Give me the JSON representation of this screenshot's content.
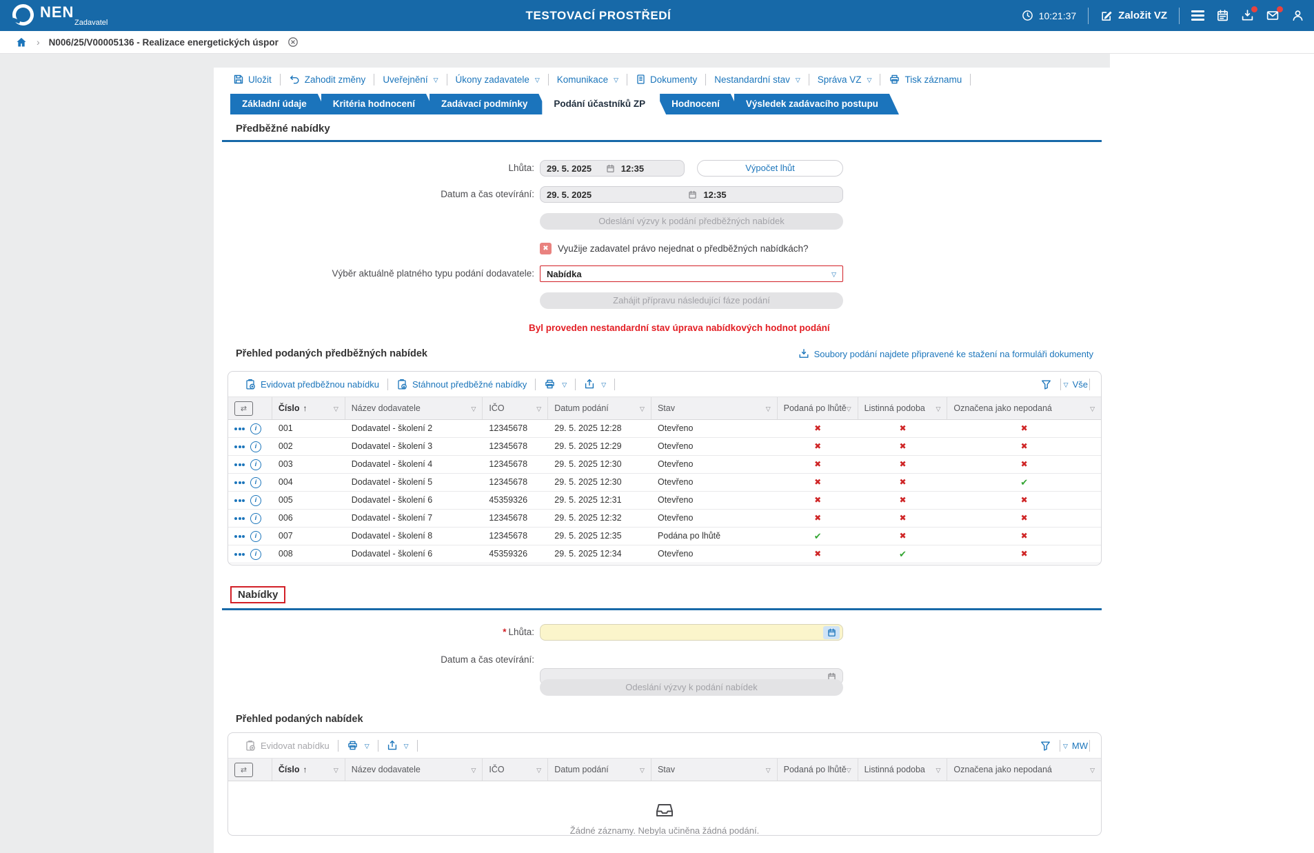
{
  "topbar": {
    "brand": "NEN",
    "brand_sub": "Zadavatel",
    "env_title": "TESTOVACÍ PROSTŘEDÍ",
    "time": "10:21:37",
    "create_vz": "Založit VZ"
  },
  "breadcrumb": {
    "item": "N006/25/V00005136 - Realizace energetických úspor"
  },
  "toolbar": {
    "items": [
      {
        "label": "Uložit"
      },
      {
        "label": "Zahodit změny"
      },
      {
        "label": "Uveřejnění"
      },
      {
        "label": "Úkony zadavatele"
      },
      {
        "label": "Komunikace"
      },
      {
        "label": "Dokumenty"
      },
      {
        "label": "Nestandardní stav"
      },
      {
        "label": "Správa VZ"
      },
      {
        "label": "Tisk záznamu"
      }
    ]
  },
  "tabs": [
    {
      "label": "Základní údaje"
    },
    {
      "label": "Kritéria hodnocení"
    },
    {
      "label": "Zadávací podmínky"
    },
    {
      "label": "Podání účastníků ZP"
    },
    {
      "label": "Hodnocení"
    },
    {
      "label": "Výsledek zadávacího postupu"
    }
  ],
  "table_columns": [
    "Číslo",
    "Název dodavatele",
    "IČO",
    "Datum podání",
    "Stav",
    "Podaná po lhůtě",
    "Listinná podoba",
    "Označena jako nepodaná"
  ],
  "section1": {
    "title": "Předběžné nabídky",
    "deadline_label": "Lhůta:",
    "deadline_date": "29. 5. 2025",
    "deadline_time": "12:35",
    "calc_btn": "Výpočet lhůt",
    "opening_label": "Datum a čas otevírání:",
    "opening_date": "29. 5. 2025",
    "opening_time": "12:35",
    "send_call_btn": "Odeslání výzvy k podání předběžných nabídek",
    "question": "Využije zadavatel právo nejednat o předběžných nabídkách?",
    "type_label": "Výběr aktuálně platného typu podání dodavatele:",
    "type_value": "Nabídka",
    "next_phase_btn": "Zahájit přípravu následující fáze podání",
    "warning": "Byl proveden nestandardní stav úprava nabídkových hodnot podání",
    "overview_title": "Přehled podaných předběžných nabídek",
    "files_link": "Soubory podání najdete připravené ke stažení na formuláři dokumenty",
    "tb_register": "Evidovat předběžnou nabídku",
    "tb_download": "Stáhnout předběžné nabídky",
    "filter_preset": "Vše",
    "rows": [
      {
        "cislo": "001",
        "nazev": "Dodavatel - školení 2",
        "ico": "12345678",
        "datum": "29. 5. 2025 12:28",
        "stav": "Otevřeno",
        "po_lhute": false,
        "listinna": false,
        "nepodana": false
      },
      {
        "cislo": "002",
        "nazev": "Dodavatel - školení 3",
        "ico": "12345678",
        "datum": "29. 5. 2025 12:29",
        "stav": "Otevřeno",
        "po_lhute": false,
        "listinna": false,
        "nepodana": false
      },
      {
        "cislo": "003",
        "nazev": "Dodavatel - školení 4",
        "ico": "12345678",
        "datum": "29. 5. 2025 12:30",
        "stav": "Otevřeno",
        "po_lhute": false,
        "listinna": false,
        "nepodana": false
      },
      {
        "cislo": "004",
        "nazev": "Dodavatel - školení 5",
        "ico": "12345678",
        "datum": "29. 5. 2025 12:30",
        "stav": "Otevřeno",
        "po_lhute": false,
        "listinna": false,
        "nepodana": true
      },
      {
        "cislo": "005",
        "nazev": "Dodavatel - školení 6",
        "ico": "45359326",
        "datum": "29. 5. 2025 12:31",
        "stav": "Otevřeno",
        "po_lhute": false,
        "listinna": false,
        "nepodana": false
      },
      {
        "cislo": "006",
        "nazev": "Dodavatel - školení 7",
        "ico": "12345678",
        "datum": "29. 5. 2025 12:32",
        "stav": "Otevřeno",
        "po_lhute": false,
        "listinna": false,
        "nepodana": false
      },
      {
        "cislo": "007",
        "nazev": "Dodavatel - školení 8",
        "ico": "12345678",
        "datum": "29. 5. 2025 12:35",
        "stav": "Podána po lhůtě",
        "po_lhute": true,
        "listinna": false,
        "nepodana": false
      },
      {
        "cislo": "008",
        "nazev": "Dodavatel - školení 6",
        "ico": "45359326",
        "datum": "29. 5. 2025 12:34",
        "stav": "Otevřeno",
        "po_lhute": false,
        "listinna": true,
        "nepodana": false
      }
    ]
  },
  "section2": {
    "title": "Nabídky",
    "required_mark": "*",
    "deadline_label": "Lhůta:",
    "opening_label": "Datum a čas otevírání:",
    "send_call_btn": "Odeslání výzvy k podání nabídek",
    "overview_title": "Přehled podaných nabídek",
    "tb_register": "Evidovat nabídku",
    "filter_preset": "MW",
    "empty_text": "Žádné záznamy. Nebyla učiněna žádná podání."
  },
  "colors": {
    "topbar": "#1769a8",
    "accent": "#1b75bb",
    "danger": "#e31e24",
    "success": "#33a532"
  }
}
